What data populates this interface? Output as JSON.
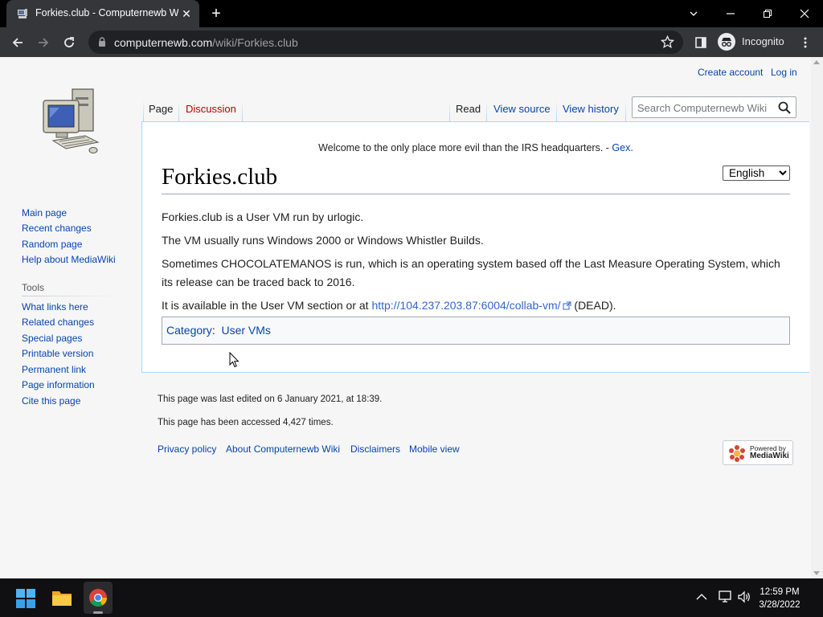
{
  "browser": {
    "tab_title": "Forkies.club - Computernewb Wiki",
    "url_host": "computernewb.com",
    "url_path": "/wiki/Forkies.club",
    "incognito_label": "Incognito"
  },
  "personal": {
    "create_account": "Create account",
    "log_in": "Log in"
  },
  "tabs": {
    "page": "Page",
    "discussion": "Discussion",
    "read": "Read",
    "view_source": "View source",
    "view_history": "View history"
  },
  "search": {
    "placeholder": "Search Computernewb Wiki"
  },
  "notice": {
    "text": "Welcome to the only place more evil than the IRS headquarters. - ",
    "link": "Gex."
  },
  "language": {
    "selected": "English"
  },
  "article": {
    "title": "Forkies.club",
    "p1": "Forkies.club is a User VM run by urlogic.",
    "p2": "The VM usually runs Windows 2000 or Windows Whistler Builds.",
    "p3": "Sometimes CHOCOLATEMANOS is run, which is an operating system based off the Last Measure Operating System, which its release can be traced back to 2016.",
    "p4_before": "It is available in the User VM section or at ",
    "p4_link": "http://104.237.203.87:6004/collab-vm/",
    "p4_after": " (DEAD).",
    "category_label": "Category",
    "category_sep": ":",
    "category_value": "User VMs"
  },
  "sidebar": {
    "nav": [
      "Main page",
      "Recent changes",
      "Random page",
      "Help about MediaWiki"
    ],
    "tools_heading": "Tools",
    "tools": [
      "What links here",
      "Related changes",
      "Special pages",
      "Printable version",
      "Permanent link",
      "Page information",
      "Cite this page"
    ]
  },
  "footer": {
    "last_edited": "This page was last edited on 6 January 2021, at 18:39.",
    "accessed": "This page has been accessed 4,427 times.",
    "links": [
      "Privacy policy",
      "About Computernewb Wiki",
      "Disclaimers",
      "Mobile view"
    ],
    "powered_by_line1": "Powered by",
    "powered_by_line2": "MediaWiki"
  },
  "taskbar": {
    "time": "12:59 PM",
    "date": "3/28/2022"
  },
  "colors": {
    "link": "#0645ad",
    "link_red": "#ba0000",
    "external_link": "#3366cc",
    "border_blue": "#a7d7f9",
    "chrome_dark": "#35363a"
  }
}
